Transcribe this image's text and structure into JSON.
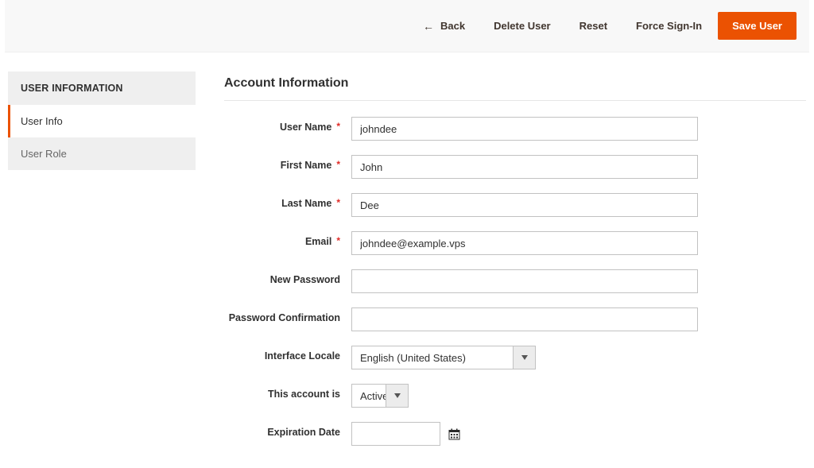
{
  "topbar": {
    "back": "Back",
    "delete_user": "Delete User",
    "reset": "Reset",
    "force_signin": "Force Sign-In",
    "save_user": "Save User"
  },
  "sidebar": {
    "header": "USER INFORMATION",
    "items": [
      {
        "label": "User Info"
      },
      {
        "label": "User Role"
      }
    ]
  },
  "section": {
    "title": "Account Information"
  },
  "form": {
    "username": {
      "label": "User Name",
      "value": "johndee"
    },
    "firstname": {
      "label": "First Name",
      "value": "John"
    },
    "lastname": {
      "label": "Last Name",
      "value": "Dee"
    },
    "email": {
      "label": "Email",
      "value": "johndee@example.vps"
    },
    "newpassword": {
      "label": "New Password",
      "value": ""
    },
    "pwconfirm": {
      "label": "Password Confirmation",
      "value": ""
    },
    "locale": {
      "label": "Interface Locale",
      "value": "English (United States)"
    },
    "account": {
      "label": "This account is",
      "value": "Active"
    },
    "expiration": {
      "label": "Expiration Date",
      "value": ""
    }
  }
}
